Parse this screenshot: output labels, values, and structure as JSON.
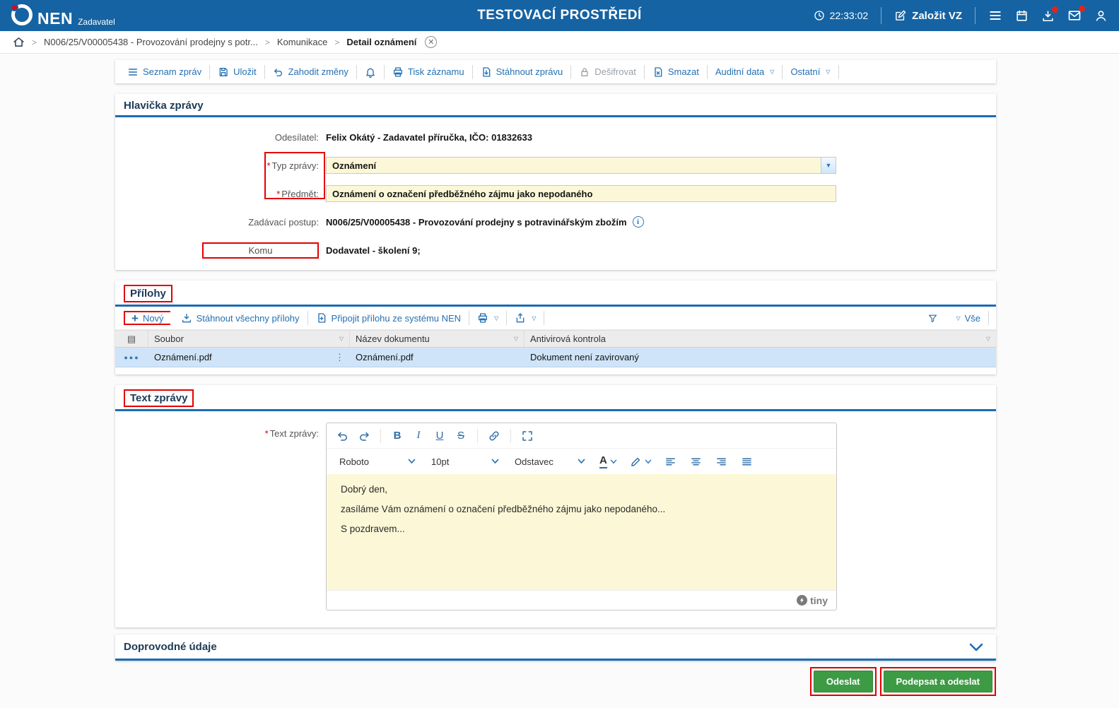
{
  "colors": {
    "header": "#1563a3",
    "accent-red": "#e30613",
    "link": "#2470b3",
    "section-line": "#1b6cb3",
    "field-yellow": "#fcf8d7",
    "row-selected": "#cfe4f8",
    "green": "#3e9b45",
    "annotation": "#e30000"
  },
  "ui": {
    "required_marker": "*"
  },
  "header": {
    "brand": "NEN",
    "brand_subtitle": "Zadavatel",
    "env_title": "TESTOVACÍ PROSTŘEDÍ",
    "time": "22:33:02",
    "create_vz": "Založit VZ"
  },
  "breadcrumb": {
    "items": [
      "N006/25/V00005438 - Provozování prodejny s potr...",
      "Komunikace",
      "Detail oznámení"
    ]
  },
  "toolbar": {
    "items": [
      "Seznam zpráv",
      "Uložit",
      "Zahodit změny",
      "Tisk záznamu",
      "Stáhnout zprávu",
      "Dešifrovat",
      "Smazat",
      "Auditní data",
      "Ostatní"
    ]
  },
  "message_header": {
    "title": "Hlavička zprávy",
    "sender_label": "Odesílatel:",
    "sender_value": "Felix Okátý - Zadavatel příručka, IČO: 01832633",
    "type_label": "Typ zprávy:",
    "type_value": "Oznámení",
    "subject_label": "Předmět:",
    "subject_value": "Oznámení o označení předběžného zájmu jako nepodaného",
    "procedure_label": "Zadávací postup:",
    "procedure_value": "N006/25/V00005438 - Provozování prodejny s potravinářským zbožím",
    "to_label": "Komu",
    "to_value": "Dodavatel - školení 9;"
  },
  "attachments": {
    "title": "Přílohy",
    "new_label": "Nový",
    "download_all_label": "Stáhnout všechny přílohy",
    "attach_from_nen_label": "Připojit přílohu ze systému NEN",
    "filter_all_label": "Vše",
    "columns": [
      "Soubor",
      "Název dokumentu",
      "Antivirová kontrola"
    ],
    "rows": [
      {
        "file": "Oznámení.pdf",
        "doc_name": "Oznámení.pdf",
        "antivirus": "Dokument není zavirovaný"
      }
    ]
  },
  "message_body": {
    "title": "Text zprávy",
    "label": "Text zprávy:",
    "editor": {
      "font_name": "Roboto",
      "font_size": "10pt",
      "block_format": "Odstavec",
      "paragraphs": [
        "Dobrý den,",
        "zasíláme Vám oznámení o označení předběžného zájmu jako nepodaného...",
        "S pozdravem..."
      ],
      "brand": "tiny"
    }
  },
  "accompanying": {
    "title": "Doprovodné údaje"
  },
  "footer": {
    "send_label": "Odeslat",
    "sign_send_label": "Podepsat a odeslat"
  }
}
